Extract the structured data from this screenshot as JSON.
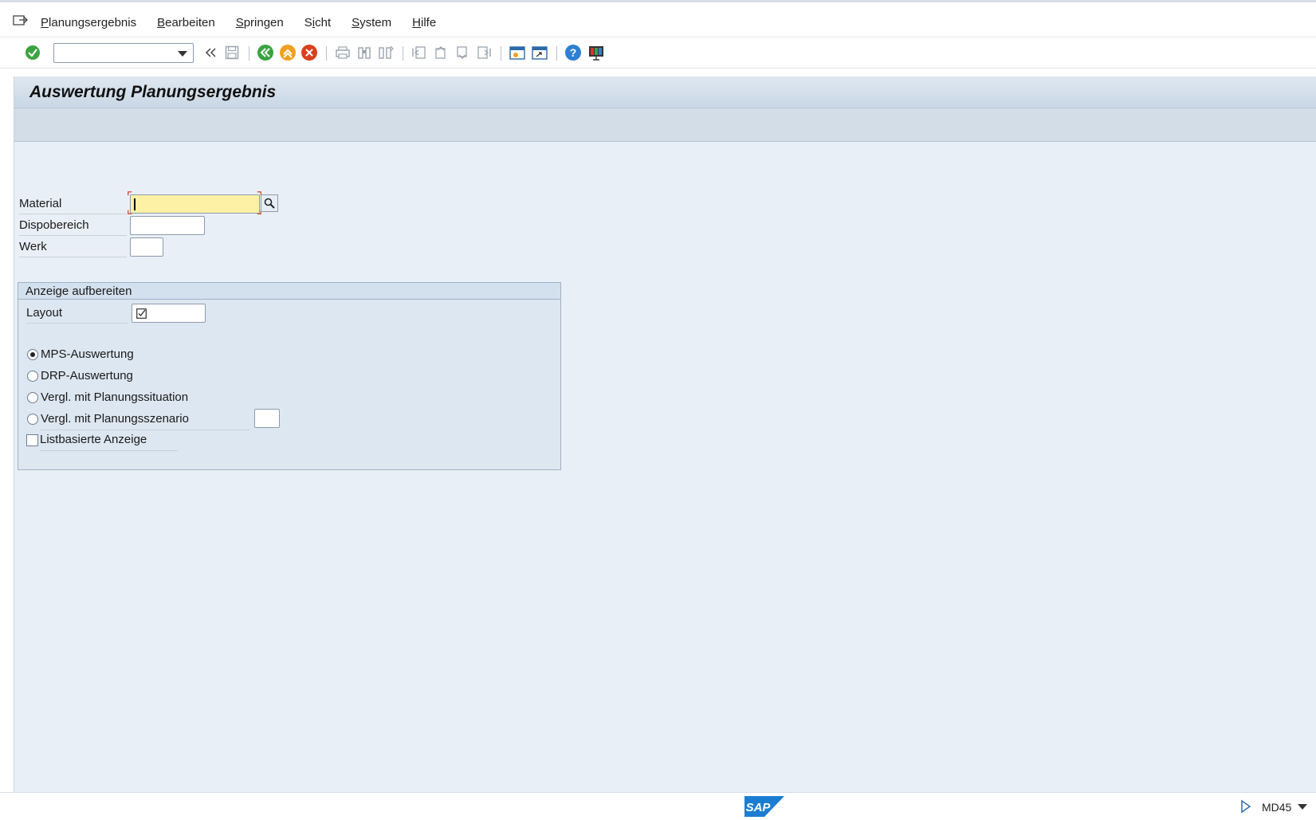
{
  "menu": {
    "items": [
      {
        "accel": "P",
        "rest": "lanungsergebnis"
      },
      {
        "accel": "B",
        "rest": "earbeiten"
      },
      {
        "accel": "S",
        "rest": "pringen"
      },
      {
        "accel": "S",
        "rest": "icht",
        "accel_pos": 1,
        "full": "Sicht"
      },
      {
        "accel": "S",
        "rest": "ystem"
      },
      {
        "accel": "H",
        "rest": "ilfe"
      }
    ],
    "labels": [
      "Planungsergebnis",
      "Bearbeiten",
      "Springen",
      "Sicht",
      "System",
      "Hilfe"
    ]
  },
  "toolbar": {
    "command_field_value": "",
    "icons": [
      "enter-icon",
      "back-icon",
      "exit-icon",
      "cancel-icon",
      "save-icon",
      "print-icon",
      "find-icon",
      "find-next-icon",
      "first-page-icon",
      "previous-page-icon",
      "next-page-icon",
      "last-page-icon",
      "new-session-icon",
      "shortcut-icon",
      "help-icon",
      "customize-layout-icon"
    ]
  },
  "page": {
    "title": "Auswertung Planungsergebnis"
  },
  "form": {
    "material_label": "Material",
    "material_value": "",
    "dispobereich_label": "Dispobereich",
    "dispobereich_value": "",
    "werk_label": "Werk",
    "werk_value": ""
  },
  "group": {
    "title": "Anzeige aufbereiten",
    "layout_label": "Layout",
    "options": [
      "MPS-Auswertung",
      "DRP-Auswertung",
      "Vergl. mit Planungssituation",
      "Vergl. mit Planungsszenario"
    ],
    "selected_option": "MPS-Auswertung",
    "scenario_value": "",
    "checkbox_label": "Listbasierte Anzeige",
    "checkbox_checked": false
  },
  "status": {
    "transaction": "MD45",
    "logo_text": "SAP"
  },
  "colors": {
    "accent_green": "#3aa340",
    "exit_orange": "#f0a020",
    "cancel_red": "#d9401f",
    "required_field": "#fdf1a6",
    "sap_blue": "#1b7dd1"
  }
}
